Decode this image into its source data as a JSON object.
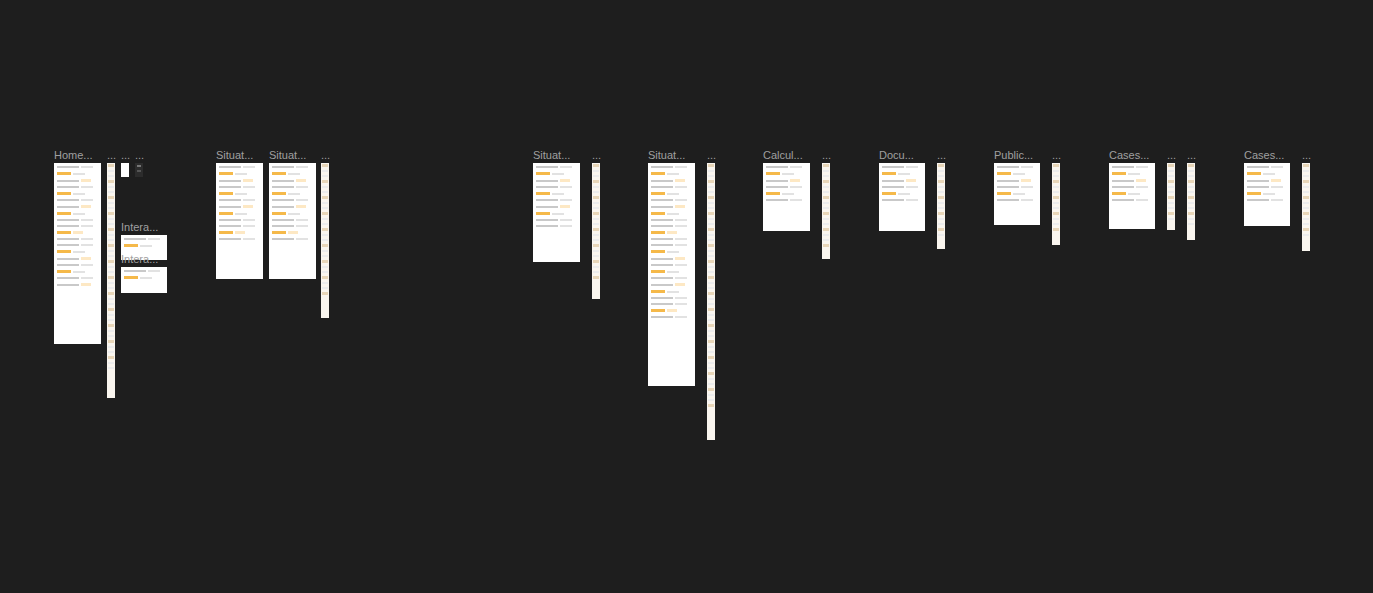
{
  "canvas": {
    "frames": [
      {
        "label": "Home...",
        "kind": "page"
      },
      {
        "label": "...",
        "kind": "strip"
      },
      {
        "label": "...",
        "kind": "page"
      },
      {
        "label": "...",
        "kind": "dark"
      },
      {
        "label": "Intera...",
        "kind": "page"
      },
      {
        "label": "Intera...",
        "kind": "page"
      },
      {
        "label": "Situat...",
        "kind": "page"
      },
      {
        "label": "Situat...",
        "kind": "page"
      },
      {
        "label": "...",
        "kind": "strip"
      },
      {
        "label": "Situat...",
        "kind": "page"
      },
      {
        "label": "...",
        "kind": "strip"
      },
      {
        "label": "Situat...",
        "kind": "page"
      },
      {
        "label": "...",
        "kind": "strip"
      },
      {
        "label": "Calcul...",
        "kind": "page"
      },
      {
        "label": "...",
        "kind": "strip"
      },
      {
        "label": "Docu...",
        "kind": "page"
      },
      {
        "label": "...",
        "kind": "strip"
      },
      {
        "label": "Public...",
        "kind": "page"
      },
      {
        "label": "...",
        "kind": "strip"
      },
      {
        "label": "Cases...",
        "kind": "page"
      },
      {
        "label": "...",
        "kind": "strip"
      },
      {
        "label": "...",
        "kind": "strip"
      },
      {
        "label": "Cases...",
        "kind": "page"
      },
      {
        "label": "...",
        "kind": "strip"
      }
    ]
  }
}
